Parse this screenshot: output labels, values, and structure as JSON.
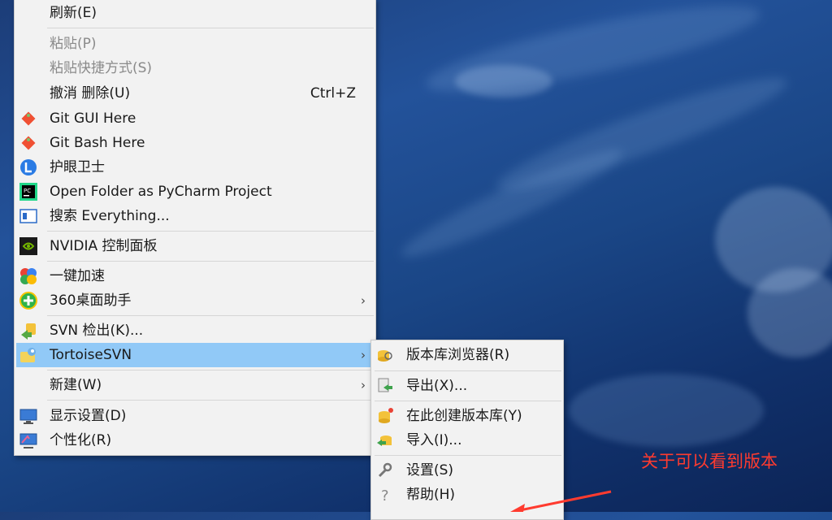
{
  "main_menu": {
    "refresh": "刷新(E)",
    "paste": "粘贴(P)",
    "paste_shortcut": "粘贴快捷方式(S)",
    "undo": "撤消 删除(U)",
    "undo_key": "Ctrl+Z",
    "git_gui": "Git GUI Here",
    "git_bash": "Git Bash Here",
    "eye_guard": "护眼卫士",
    "pycharm": "Open Folder as PyCharm Project",
    "everything": "搜索 Everything...",
    "nvidia": "NVIDIA 控制面板",
    "speedup": "一键加速",
    "desk360": "360桌面助手",
    "svn_checkout": "SVN 检出(K)...",
    "tortoise": "TortoiseSVN",
    "new": "新建(W)",
    "display": "显示设置(D)",
    "personalize": "个性化(R)"
  },
  "sub_menu": {
    "repo_browser": "版本库浏览器(R)",
    "export": "导出(X)...",
    "create_repo": "在此创建版本库(Y)",
    "import": "导入(I)...",
    "settings": "设置(S)",
    "help": "帮助(H)"
  },
  "annotation": "关于可以看到版本",
  "colors": {
    "highlight": "#91c9f7",
    "annotation": "#ff3b2f",
    "menu_bg": "#f2f2f2"
  }
}
